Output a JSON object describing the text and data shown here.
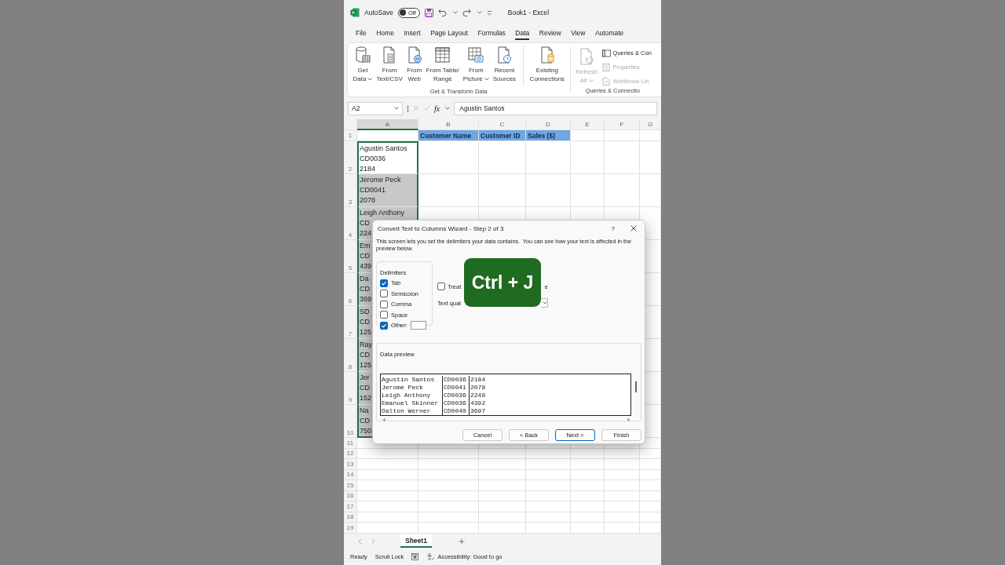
{
  "title_bar": {
    "autosave_label": "AutoSave",
    "autosave": {
      "on": false,
      "label": "Off"
    },
    "title": "Book1 - Excel"
  },
  "ribbon_tabs": [
    {
      "label": "File",
      "selected": false
    },
    {
      "label": "Home",
      "selected": false
    },
    {
      "label": "Insert",
      "selected": false
    },
    {
      "label": "Page Layout",
      "selected": false
    },
    {
      "label": "Formulas",
      "selected": false
    },
    {
      "label": "Data",
      "selected": true
    },
    {
      "label": "Review",
      "selected": false
    },
    {
      "label": "View",
      "selected": false
    },
    {
      "label": "Automate",
      "selected": false
    }
  ],
  "ribbon": {
    "groups": [
      {
        "label": "Get & Transform Data",
        "buttons": [
          {
            "kind": "database",
            "lines": [
              "Get",
              "Data"
            ],
            "dropdown": true,
            "disabled": false,
            "separated": false
          },
          {
            "kind": "text",
            "lines": [
              "From",
              "Text/CSV"
            ],
            "dropdown": false,
            "disabled": false,
            "separated": false
          },
          {
            "kind": "web",
            "lines": [
              "From",
              "Web"
            ],
            "dropdown": false,
            "disabled": false,
            "separated": false
          },
          {
            "kind": "table",
            "lines": [
              "From Table/",
              "Range"
            ],
            "dropdown": false,
            "disabled": false,
            "separated": false
          },
          {
            "kind": "picture",
            "lines": [
              "From",
              "Picture"
            ],
            "dropdown": true,
            "disabled": false,
            "separated": false
          },
          {
            "kind": "recent",
            "lines": [
              "Recent",
              "Sources"
            ],
            "dropdown": false,
            "disabled": false,
            "separated": false
          },
          {
            "kind": "connections",
            "lines": [
              "Existing",
              "Connections"
            ],
            "dropdown": false,
            "disabled": false,
            "separated": true
          }
        ]
      },
      {
        "label": "Queries & Connectio",
        "buttons": [
          {
            "kind": "refresh",
            "lines": [
              "Refresh",
              "All"
            ],
            "dropdown": true,
            "disabled": true,
            "separated": false
          }
        ],
        "small_items": [
          {
            "kind": "queries",
            "label": "Queries & Con",
            "disabled": false
          },
          {
            "kind": "properties",
            "label": "Properties",
            "disabled": true
          },
          {
            "kind": "links",
            "label": "Workbook Lin",
            "disabled": true
          }
        ]
      }
    ]
  },
  "formula_bar": {
    "name_box": "A2",
    "fx_label": "fx",
    "content": "Agustin Santos"
  },
  "sheet": {
    "columns": [
      {
        "label": "A",
        "selected": true
      },
      {
        "label": "B",
        "selected": false
      },
      {
        "label": "C",
        "selected": false
      },
      {
        "label": "D",
        "selected": false
      },
      {
        "label": "E",
        "selected": false
      },
      {
        "label": "F",
        "selected": false
      },
      {
        "label": "G",
        "selected": false
      }
    ],
    "header_row": {
      "number": "1",
      "cells": [
        "Customer Name",
        "Customer ID",
        "Sales ($)"
      ]
    },
    "rows": [
      {
        "number": "2",
        "active": true,
        "lines": [
          "Agustin Santos",
          "CD0036",
          "2184"
        ]
      },
      {
        "number": "3",
        "active": false,
        "lines": [
          "Jerome Peck",
          "CD0041",
          "2078"
        ]
      },
      {
        "number": "4",
        "active": false,
        "lines": [
          "Leigh Anthony",
          "CD",
          "224"
        ]
      },
      {
        "number": "5",
        "active": false,
        "lines": [
          "Em",
          "CD",
          "439"
        ]
      },
      {
        "number": "6",
        "active": false,
        "lines": [
          "Da",
          "CD",
          "369"
        ]
      },
      {
        "number": "7",
        "active": false,
        "lines": [
          "SD",
          "CD",
          "125"
        ]
      },
      {
        "number": "8",
        "active": false,
        "lines": [
          "Ray",
          "CD",
          "125"
        ]
      },
      {
        "number": "9",
        "active": false,
        "lines": [
          "Jer",
          "CD",
          "152"
        ]
      },
      {
        "number": "10",
        "active": false,
        "lines": [
          "Na",
          "CD",
          "750"
        ]
      }
    ],
    "empty_rows": [
      "11",
      "12",
      "13",
      "14",
      "15",
      "16",
      "17",
      "18",
      "19"
    ]
  },
  "dialog": {
    "title": "Convert Text to Columns Wizard - Step 2 of 3",
    "help": "?",
    "description": "This screen lets you set the delimiters your data contains.  You can see how your text is affected in the preview below.",
    "delimiters": {
      "title": "Delimiters",
      "options": [
        {
          "label": "Tab",
          "checked": true
        },
        {
          "label": "Semicolon",
          "checked": false
        },
        {
          "label": "Comma",
          "checked": false
        },
        {
          "label": "Space",
          "checked": false
        },
        {
          "label": "Other:",
          "checked": true
        }
      ]
    },
    "treat": {
      "label": "Treat",
      "tail": "e",
      "checked": false
    },
    "qualifier_label": "Text qual",
    "preview": {
      "title": "Data preview",
      "rows": [
        [
          "Agustin Santos",
          "CD0036",
          "2184"
        ],
        [
          "Jerome Peck",
          "CD0041",
          "2078"
        ],
        [
          "Leigh Anthony",
          "CD0036",
          "2248"
        ],
        [
          "Emanuel Skinner",
          "CD0036",
          "4392"
        ],
        [
          "Dalton Werner",
          "CD0040",
          "3697"
        ]
      ]
    },
    "buttons": [
      {
        "label": "Cancel",
        "default": false
      },
      {
        "label": "< Back",
        "default": false
      },
      {
        "label": "Next >",
        "default": true
      },
      {
        "label": "Finish",
        "default": false
      }
    ]
  },
  "shortcut_overlay": {
    "text": "Ctrl + J"
  },
  "sheet_tabs": [
    {
      "label": "Sheet1",
      "selected": true
    }
  ],
  "status_bar": {
    "mode": "Ready",
    "scroll_lock": "Scroll Lock",
    "accessibility": "Accessibility: Good to go"
  }
}
